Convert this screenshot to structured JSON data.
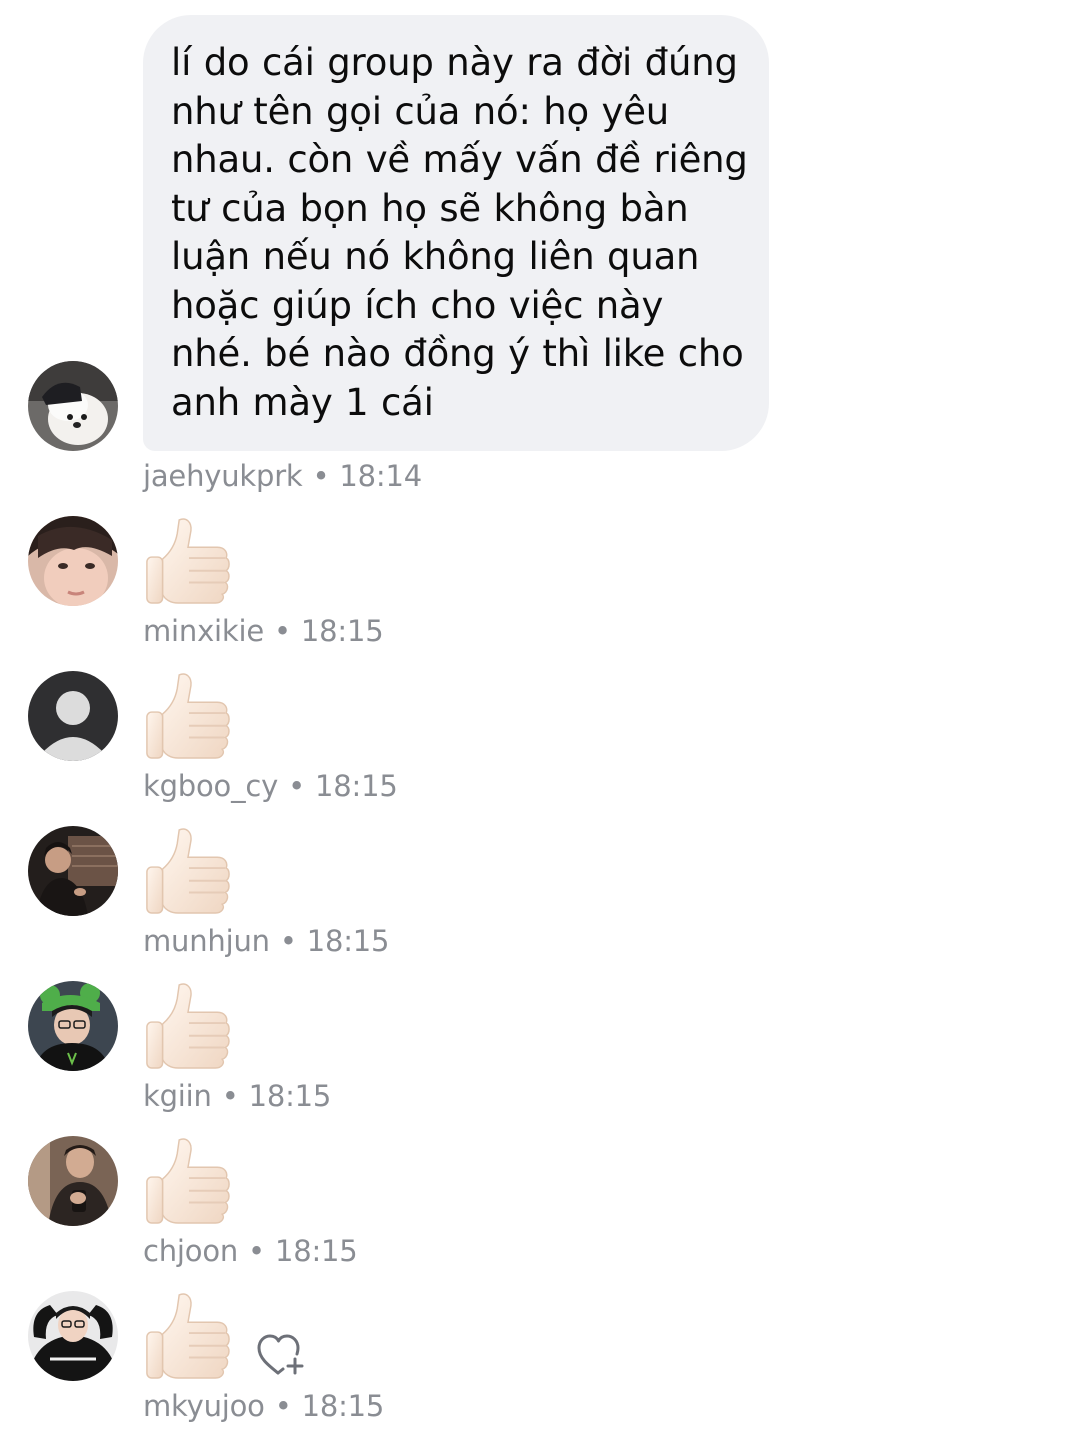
{
  "messages": {
    "main": {
      "text": "lí do cái group này ra đời đúng như tên gọi của nó: họ yêu nhau. còn về mấy vấn đề riêng tư của bọn họ sẽ không bàn luận nếu nó không liên quan hoặc giúp ích cho việc này nhé. bé nào đồng ý thì like cho anh mày 1 cái",
      "username": "jaehyukprk",
      "time": "18:14"
    },
    "likes": [
      {
        "username": "minxikie",
        "time": "18:15",
        "reaction": "thumbs-up"
      },
      {
        "username": "kgboo_cy",
        "time": "18:15",
        "reaction": "thumbs-up"
      },
      {
        "username": "munhjun",
        "time": "18:15",
        "reaction": "thumbs-up"
      },
      {
        "username": "kgiin",
        "time": "18:15",
        "reaction": "thumbs-up"
      },
      {
        "username": "chjoon",
        "time": "18:15",
        "reaction": "thumbs-up"
      },
      {
        "username": "mkyujoo",
        "time": "18:15",
        "reaction": "thumbs-up"
      }
    ],
    "separator": "•"
  },
  "icons": {
    "reaction": "thumbs-up-emoji-icon",
    "react_button": "heart-plus-icon",
    "default_avatar": "default-avatar-icon"
  },
  "colors": {
    "bubble_bg": "#f0f1f4",
    "meta_text": "#8a8d93",
    "message_text": "#0c0c0c"
  }
}
